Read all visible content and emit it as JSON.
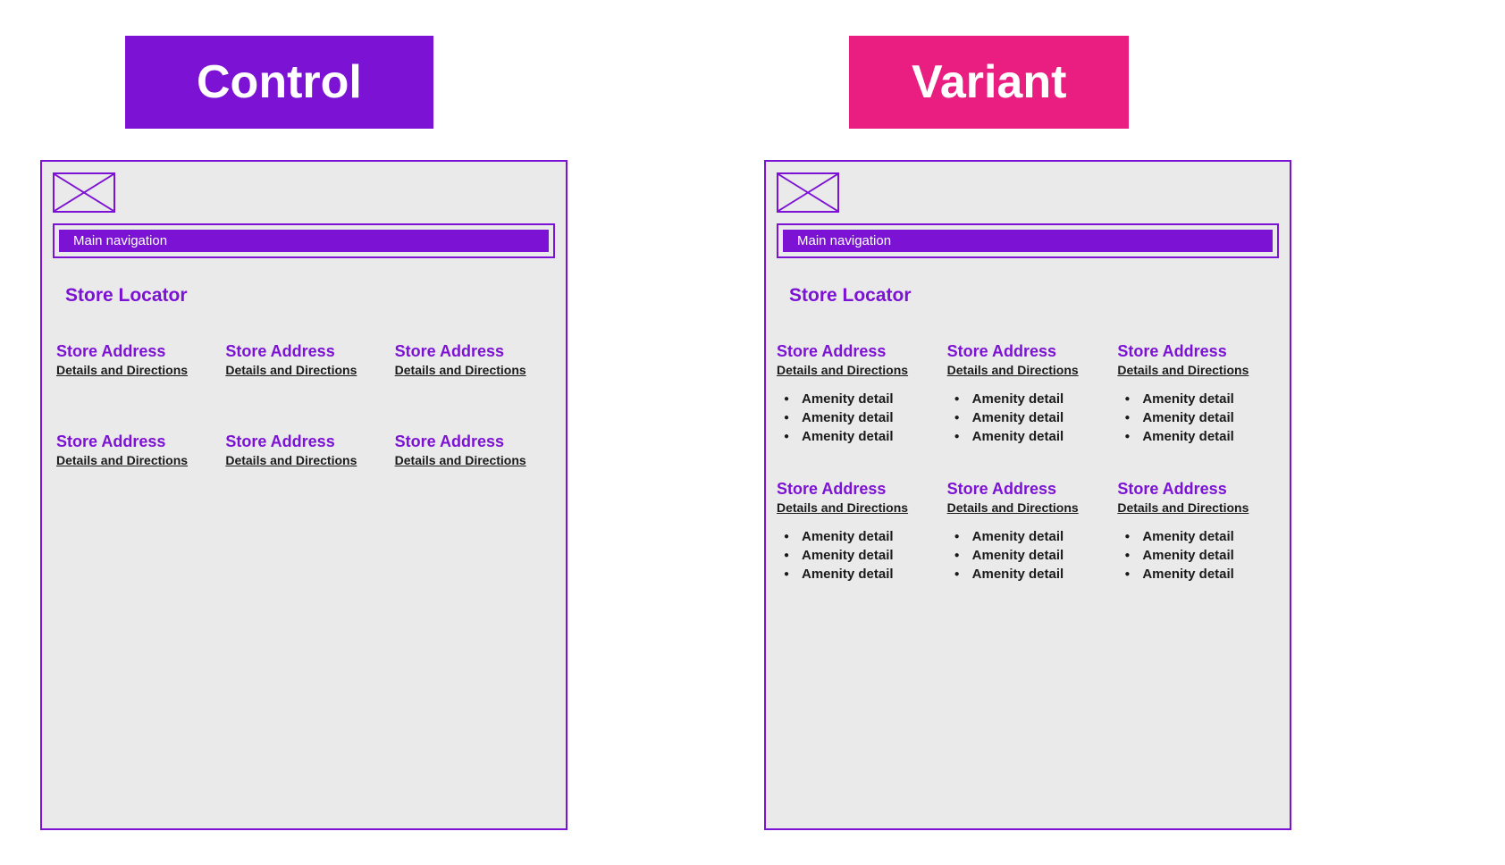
{
  "control": {
    "title": "Control",
    "nav_label": "Main navigation",
    "page_heading": "Store Locator",
    "stores": [
      {
        "address": "Store Address",
        "link": "Details and Directions"
      },
      {
        "address": "Store Address",
        "link": "Details and Directions"
      },
      {
        "address": "Store Address",
        "link": "Details and Directions"
      },
      {
        "address": "Store Address",
        "link": "Details and Directions"
      },
      {
        "address": "Store Address",
        "link": "Details and Directions"
      },
      {
        "address": "Store Address",
        "link": "Details and Directions"
      }
    ]
  },
  "variant": {
    "title": "Variant",
    "nav_label": "Main navigation",
    "page_heading": "Store Locator",
    "stores": [
      {
        "address": "Store Address",
        "link": "Details and Directions",
        "amenities": [
          "Amenity detail",
          "Amenity detail",
          "Amenity detail"
        ]
      },
      {
        "address": "Store Address",
        "link": "Details and Directions",
        "amenities": [
          "Amenity detail",
          "Amenity detail",
          "Amenity detail"
        ]
      },
      {
        "address": "Store Address",
        "link": "Details and Directions",
        "amenities": [
          "Amenity detail",
          "Amenity detail",
          "Amenity detail"
        ]
      },
      {
        "address": "Store Address",
        "link": "Details and Directions",
        "amenities": [
          "Amenity detail",
          "Amenity detail",
          "Amenity detail"
        ]
      },
      {
        "address": "Store Address",
        "link": "Details and Directions",
        "amenities": [
          "Amenity detail",
          "Amenity detail",
          "Amenity detail"
        ]
      },
      {
        "address": "Store Address",
        "link": "Details and Directions",
        "amenities": [
          "Amenity detail",
          "Amenity detail",
          "Amenity detail"
        ]
      }
    ]
  },
  "colors": {
    "control_accent": "#7c12d4",
    "variant_accent": "#e91e80"
  }
}
